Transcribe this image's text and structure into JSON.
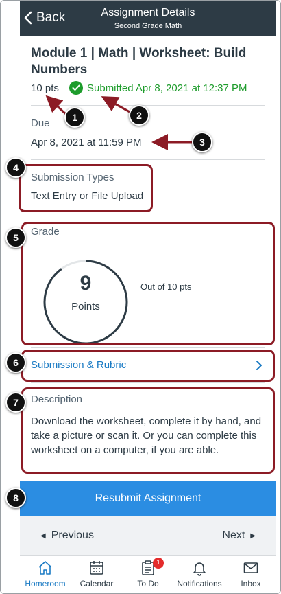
{
  "header": {
    "back_label": "Back",
    "title": "Assignment Details",
    "subtitle": "Second Grade Math"
  },
  "assignment": {
    "title": "Module 1 | Math | Worksheet: Build Numbers",
    "points": "10 pts",
    "submitted": "Submitted Apr 8, 2021 at 12:37 PM"
  },
  "due": {
    "label": "Due",
    "value": "Apr 8, 2021 at 11:59 PM"
  },
  "submission_types": {
    "label": "Submission Types",
    "value": "Text Entry or File Upload"
  },
  "grade": {
    "label": "Grade",
    "score": "9",
    "unit": "Points",
    "out_of": "Out of 10 pts",
    "fraction": 0.9
  },
  "submission_link": {
    "label": "Submission & Rubric"
  },
  "description": {
    "label": "Description",
    "text": "Download the worksheet, complete it by hand, and take a picture or scan it. Or you can complete this worksheet on a computer, if you are able."
  },
  "resubmit_label": "Resubmit Assignment",
  "pager": {
    "previous": "Previous",
    "next": "Next"
  },
  "tabs": [
    {
      "label": "Homeroom",
      "icon": "home-icon",
      "active": true
    },
    {
      "label": "Calendar",
      "icon": "calendar-icon",
      "active": false
    },
    {
      "label": "To Do",
      "icon": "todo-icon",
      "active": false,
      "badge": "1"
    },
    {
      "label": "Notifications",
      "icon": "bell-icon",
      "active": false
    },
    {
      "label": "Inbox",
      "icon": "inbox-icon",
      "active": false
    }
  ],
  "annotations": [
    "1",
    "2",
    "3",
    "4",
    "5",
    "6",
    "7",
    "8"
  ],
  "colors": {
    "header_bg": "#2d3b45",
    "accent_blue": "#2b8de2",
    "link_blue": "#1b7bc4",
    "success_green": "#1e9c2c",
    "annotation_red": "#8c1b25"
  }
}
